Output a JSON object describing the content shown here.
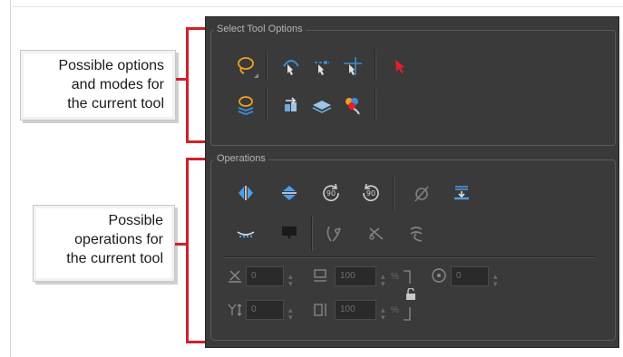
{
  "callouts": {
    "options": {
      "lines": [
        "Possible options",
        "and modes for",
        "the current tool"
      ]
    },
    "operations": {
      "lines": [
        "Possible",
        "operations for",
        "the current tool"
      ]
    }
  },
  "panel": {
    "select_tool_options_title": "Select Tool Options",
    "operations_title": "Operations",
    "fields": {
      "x_offset": "0",
      "y_offset": "0",
      "width": "100",
      "height": "100",
      "angle": "0",
      "unit_percent": "%"
    }
  },
  "colors": {
    "panel_bg": "#3a3a3a",
    "accent_red": "#d0202a",
    "icon_orange": "#f0a020",
    "icon_blue": "#3a8fd8"
  },
  "icons": {
    "options_row1": [
      "lasso-icon",
      "snap-contour-icon",
      "snap-joint-icon",
      "snap-thickness-icon",
      "select-red-arrow-icon"
    ],
    "options_row2": [
      "select-in-all-layers-icon",
      "bring-to-front-icon",
      "apply-to-all-drawings-icon",
      "select-by-color-icon"
    ],
    "ops_row1": [
      "flip-horizontal-icon",
      "flip-vertical-icon",
      "rotate-90-cw-icon",
      "rotate-90-ccw-icon",
      "no-color-icon",
      "flatten-icon"
    ],
    "ops_row2": [
      "distribute-icon",
      "create-color-art-icon",
      "smooth-icon",
      "cut-icon",
      "optimize-icon"
    ]
  }
}
